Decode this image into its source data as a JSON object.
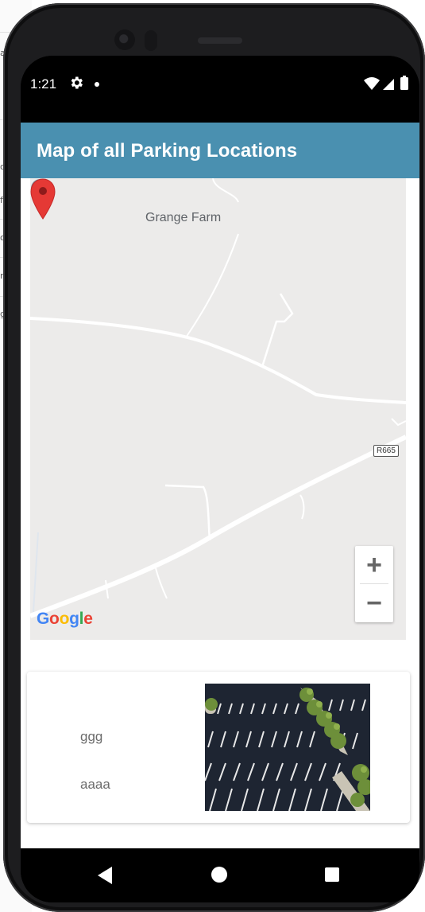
{
  "status_bar": {
    "time": "1:21",
    "icons": [
      "gear-icon",
      "notification-dot",
      "wifi-icon",
      "signal-icon",
      "battery-icon"
    ]
  },
  "app_bar": {
    "title": "Map of all Parking Locations",
    "color": "#4a90b0"
  },
  "map": {
    "poi_label": "Grange Farm",
    "road_label": "R665",
    "google_logo": "Google",
    "zoom_in": "+",
    "zoom_out": "−",
    "marker_color": "#e53935"
  },
  "parking_card": {
    "name": "ggg",
    "description": "aaaa",
    "image": "parking-lot-photo"
  },
  "nav_bar": {
    "buttons": [
      "back-icon",
      "home-icon",
      "recents-icon"
    ]
  },
  "background_editor": {
    "fragments": [
      "a",
      "o",
      "fl",
      "or",
      "r",
      "g"
    ]
  }
}
